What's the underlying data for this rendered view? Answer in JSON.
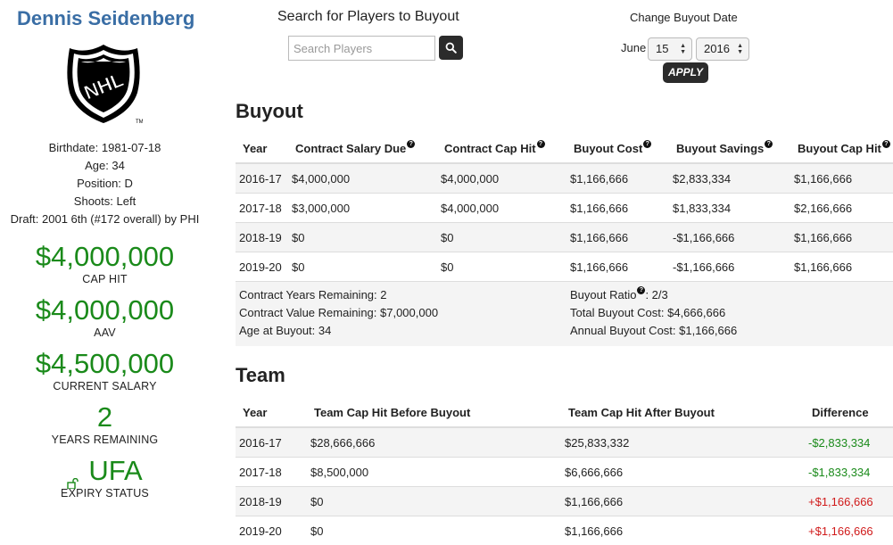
{
  "player": {
    "name": "Dennis Seidenberg",
    "logo_icon": "nhl-shield-logo",
    "bio": [
      "Birthdate: 1981-07-18",
      "Age: 34",
      "Position: D",
      "Shoots: Left",
      "Draft: 2001 6th (#172 overall) by PHI"
    ],
    "stats": {
      "cap_hit": {
        "value": "$4,000,000",
        "label": "CAP HIT"
      },
      "aav": {
        "value": "$4,000,000",
        "label": "AAV"
      },
      "current_salary": {
        "value": "$4,500,000",
        "label": "CURRENT SALARY"
      },
      "years_remaining": {
        "value": "2",
        "label": "YEARS REMAINING"
      },
      "expiry": {
        "value": "UFA",
        "label": "EXPIRY STATUS",
        "icon": "unlock-icon"
      }
    }
  },
  "search": {
    "title": "Search for Players to Buyout",
    "placeholder": "Search Players",
    "button_icon": "search-icon"
  },
  "buyout_date": {
    "title": "Change Buyout Date",
    "month": "June",
    "day": "15",
    "year": "2016",
    "apply_label": "APPLY"
  },
  "buyout": {
    "title": "Buyout",
    "headers": [
      "Year",
      "Contract Salary Due",
      "Contract Cap Hit",
      "Buyout Cost",
      "Buyout Savings",
      "Buyout Cap Hit"
    ],
    "rows": [
      [
        "2016-17",
        "$4,000,000",
        "$4,000,000",
        "$1,166,666",
        "$2,833,334",
        "$1,166,666"
      ],
      [
        "2017-18",
        "$3,000,000",
        "$4,000,000",
        "$1,166,666",
        "$1,833,334",
        "$2,166,666"
      ],
      [
        "2018-19",
        "$0",
        "$0",
        "$1,166,666",
        "-$1,166,666",
        "$1,166,666"
      ],
      [
        "2019-20",
        "$0",
        "$0",
        "$1,166,666",
        "-$1,166,666",
        "$1,166,666"
      ]
    ],
    "summary": {
      "contract_years_remaining": "Contract Years Remaining: 2",
      "contract_value_remaining": "Contract Value Remaining: $7,000,000",
      "age_at_buyout": "Age at Buyout: 34",
      "buyout_ratio_label": "Buyout Ratio",
      "buyout_ratio_value": ": 2/3",
      "total_buyout_cost": "Total Buyout Cost: $4,666,666",
      "annual_buyout_cost": "Annual Buyout Cost: $1,166,666"
    }
  },
  "team": {
    "title": "Team",
    "headers": [
      "Year",
      "Team Cap Hit Before Buyout",
      "Team Cap Hit After Buyout",
      "Difference"
    ],
    "rows": [
      [
        "2016-17",
        "$28,666,666",
        "$25,833,332",
        "-$2,833,334"
      ],
      [
        "2017-18",
        "$8,500,000",
        "$6,666,666",
        "-$1,833,334"
      ],
      [
        "2018-19",
        "$0",
        "$1,166,666",
        "+$1,166,666"
      ],
      [
        "2019-20",
        "$0",
        "$1,166,666",
        "+$1,166,666"
      ]
    ]
  },
  "colors": {
    "player_name": "#3a6ea5",
    "stat_green": "#1a8a1a",
    "positive_diff": "#1a8a1a",
    "negative_diff": "#d01a1a"
  }
}
